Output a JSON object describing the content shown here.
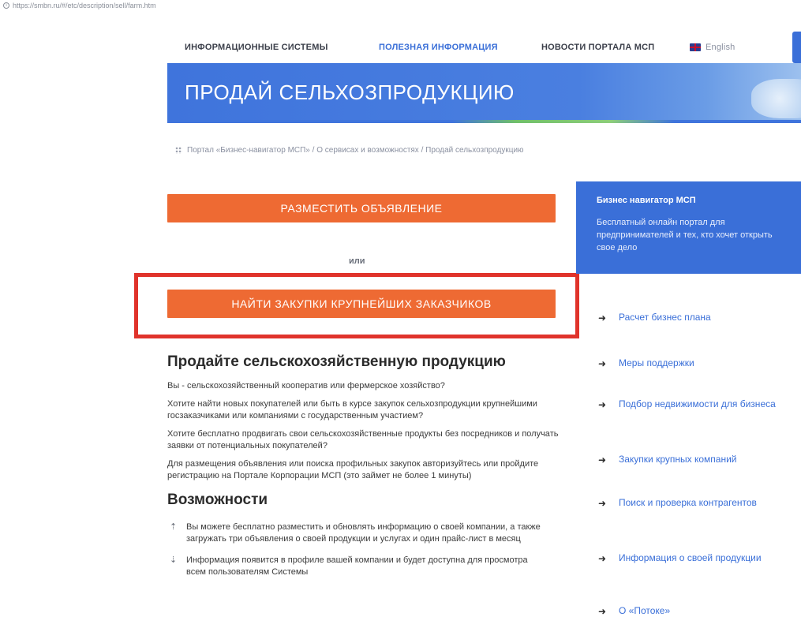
{
  "url_bar": {
    "url": "https://smbn.ru/#/etc/description/sell/farm.htm"
  },
  "topnav": {
    "items": [
      {
        "label": "ИНФОРМАЦИОННЫЕ СИСТЕМЫ"
      },
      {
        "label": "ПОЛЕЗНАЯ ИНФОРМАЦИЯ"
      },
      {
        "label": "НОВОСТИ ПОРТАЛА МСП"
      }
    ],
    "language": "English"
  },
  "banner": {
    "title": "ПРОДАЙ СЕЛЬХОЗПРОДУКЦИЮ"
  },
  "breadcrumb": {
    "text": "Портал «Бизнес-навигатор МСП» / О сервисах и возможностях / Продай сельхозпродукцию"
  },
  "actions": {
    "post_ad": "РАЗМЕСТИТЬ ОБЪЯВЛЕНИЕ",
    "or": "или",
    "find_purchases": "НАЙТИ ЗАКУПКИ КРУПНЕЙШИХ ЗАКАЗЧИКОВ"
  },
  "side_card": {
    "title": "Бизнес навигатор МСП",
    "text": "Бесплатный онлайн портал для предпринимателей и тех, кто хочет открыть свое дело"
  },
  "side_links": [
    {
      "label": "Расчет бизнес плана"
    },
    {
      "label": "Меры поддержки"
    },
    {
      "label": "Подбор недвижимости для бизнеса"
    },
    {
      "label": "Закупки крупных компаний"
    },
    {
      "label": "Поиск и проверка контрагентов"
    },
    {
      "label": "Информация о своей продукции"
    },
    {
      "label": "О «Потоке»"
    }
  ],
  "content": {
    "heading": "Продайте сельскохозяйственную продукцию",
    "paragraphs": [
      "Вы - сельскохозяйственный кооператив или фермерское хозяйство?",
      "Хотите найти новых покупателей или быть в курсе закупок сельхозпродукции крупнейшими госзаказчиками или компаниями с государственным участием?",
      "Хотите бесплатно продвигать свои сельскохозяйственные продукты без посредников и получать заявки от потенциальных покупателей?",
      "Для размещения объявления или поиска профильных закупок авторизуйтесь или пройдите регистрацию на Портале Корпорации МСП (это займет не более 1 минуты)"
    ],
    "features_heading": "Возможности",
    "features": [
      "Вы можете бесплатно разместить и обновлять информацию о своей компании, а также загружать три объявления о своей продукции и услугах и один прайс-лист в месяц",
      "Информация появится в профиле вашей компании и будет доступна для просмотра всем пользователям Системы"
    ]
  },
  "colors": {
    "accent_blue": "#3a6fd8",
    "orange": "#ee6a33",
    "highlight_red": "#e0332b"
  }
}
